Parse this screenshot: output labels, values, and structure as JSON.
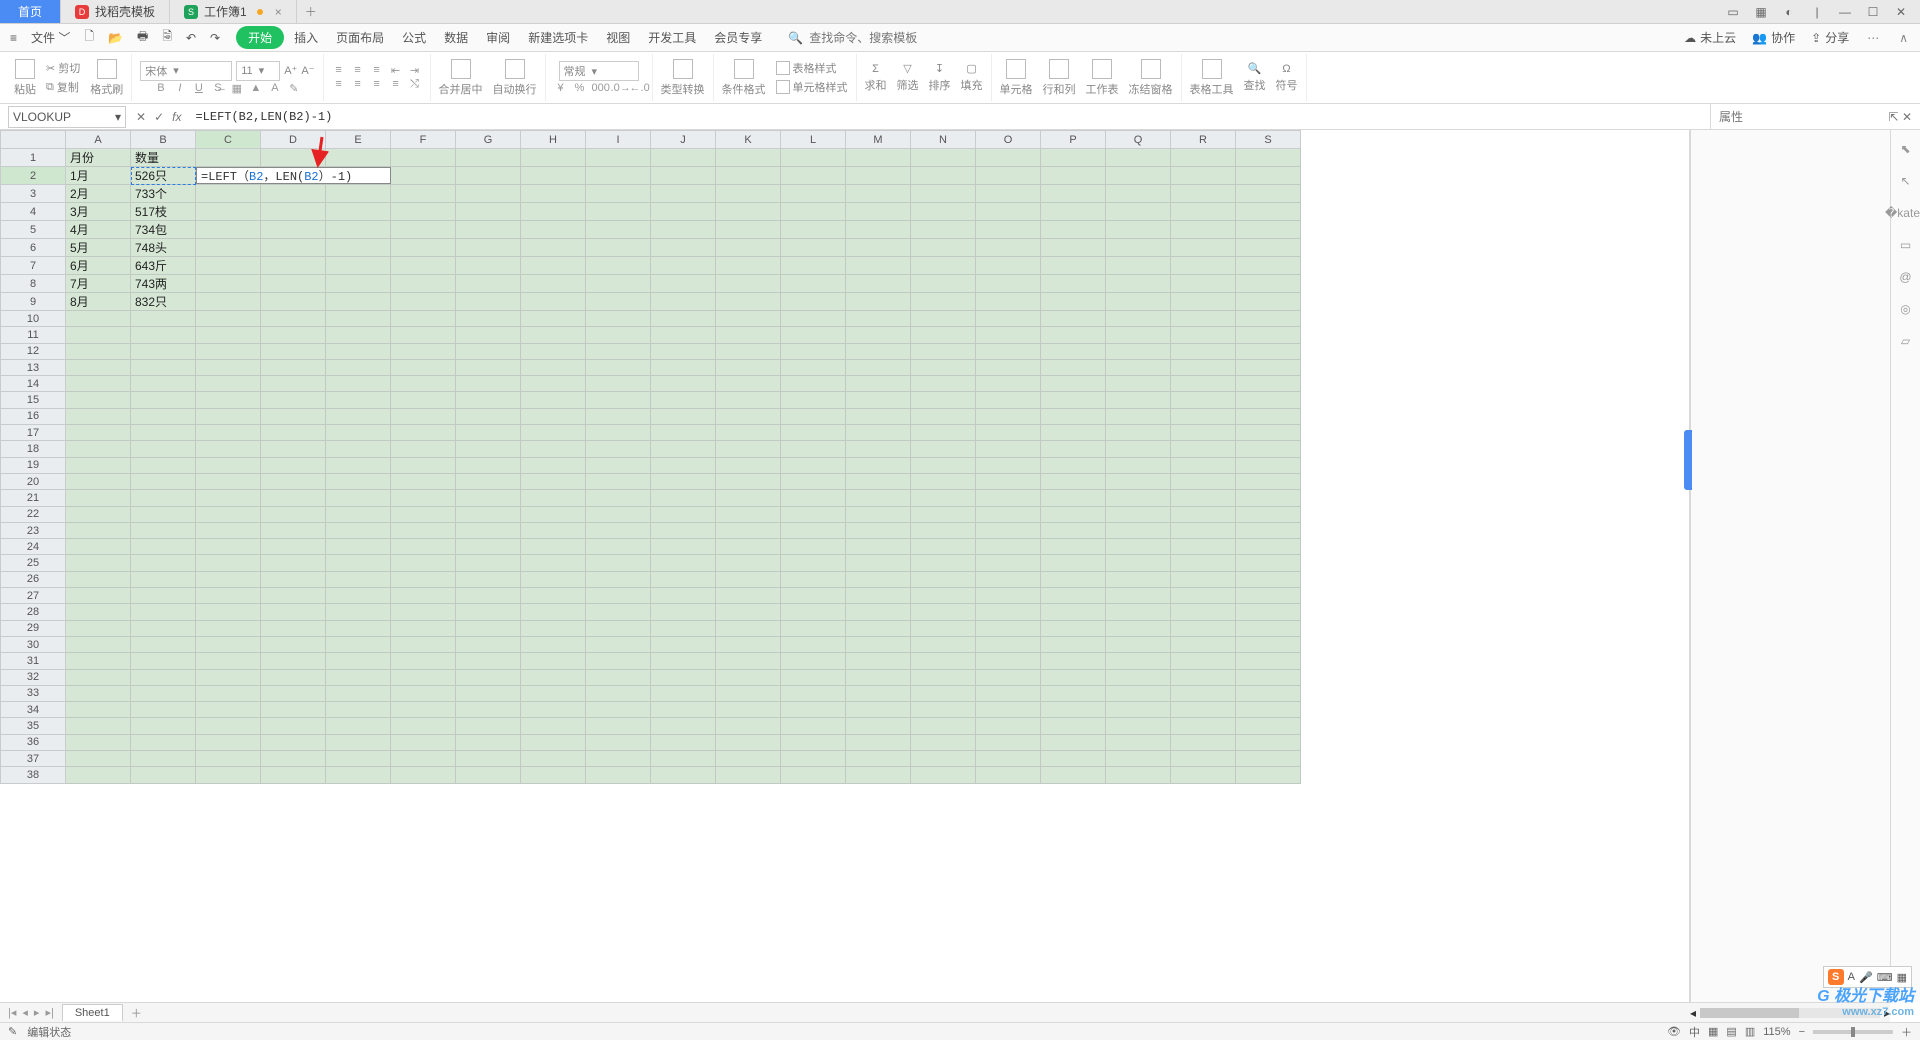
{
  "tabs": {
    "home": "首页",
    "t1": "找稻壳模板",
    "t2": "工作簿1"
  },
  "menu": {
    "file": "文件",
    "items": [
      "开始",
      "插入",
      "页面布局",
      "公式",
      "数据",
      "审阅",
      "新建选项卡",
      "视图",
      "开发工具",
      "会员专享"
    ],
    "search_ph": "查找命令、搜索模板",
    "cloud": "未上云",
    "collab": "协作",
    "share": "分享"
  },
  "ribbon": {
    "paste": "粘贴",
    "cut": "剪切",
    "copy": "复制",
    "fmt": "格式刷",
    "font_name": "宋体",
    "font_size": "11",
    "merge": "合并居中",
    "wrap": "自动换行",
    "number_fmt": "常规",
    "type_convert": "类型转换",
    "cond_fmt": "条件格式",
    "table_style": "表格样式",
    "cell_style": "单元格样式",
    "sum": "求和",
    "filter": "筛选",
    "sort": "排序",
    "fill": "填充",
    "cell": "单元格",
    "rowcol": "行和列",
    "worksheet": "工作表",
    "freeze": "冻结窗格",
    "table_tools": "表格工具",
    "find": "查找",
    "symbol": "符号"
  },
  "formula_bar": {
    "name": "VLOOKUP",
    "formula": "=LEFT(B2,LEN(B2)-1)"
  },
  "props_label": "属性",
  "columns": [
    "A",
    "B",
    "C",
    "D",
    "E",
    "F",
    "G",
    "H",
    "I",
    "J",
    "K",
    "L",
    "M",
    "N",
    "O",
    "P",
    "Q",
    "R",
    "S"
  ],
  "cells": {
    "A1": "月份",
    "B1": "数量",
    "A2": "1月",
    "B2": "526只",
    "A3": "2月",
    "B3": "733个",
    "A4": "3月",
    "B4": "517枝",
    "A5": "4月",
    "B5": "734包",
    "A6": "5月",
    "B6": "748头",
    "A7": "6月",
    "B7": "643斤",
    "A8": "7月",
    "B8": "743两",
    "A9": "8月",
    "B9": "832只"
  },
  "edit_cell": {
    "prefix": "=LEFT（",
    "ref1": "B2",
    "mid": "，LEN(",
    "ref2": "B2",
    "suffix": "）-1)"
  },
  "sheet_tab": "Sheet1",
  "status": {
    "mode": "编辑状态",
    "zoom": "115%"
  },
  "watermark": {
    "l1": "极光下载站",
    "l2": "www.xz7.com"
  }
}
